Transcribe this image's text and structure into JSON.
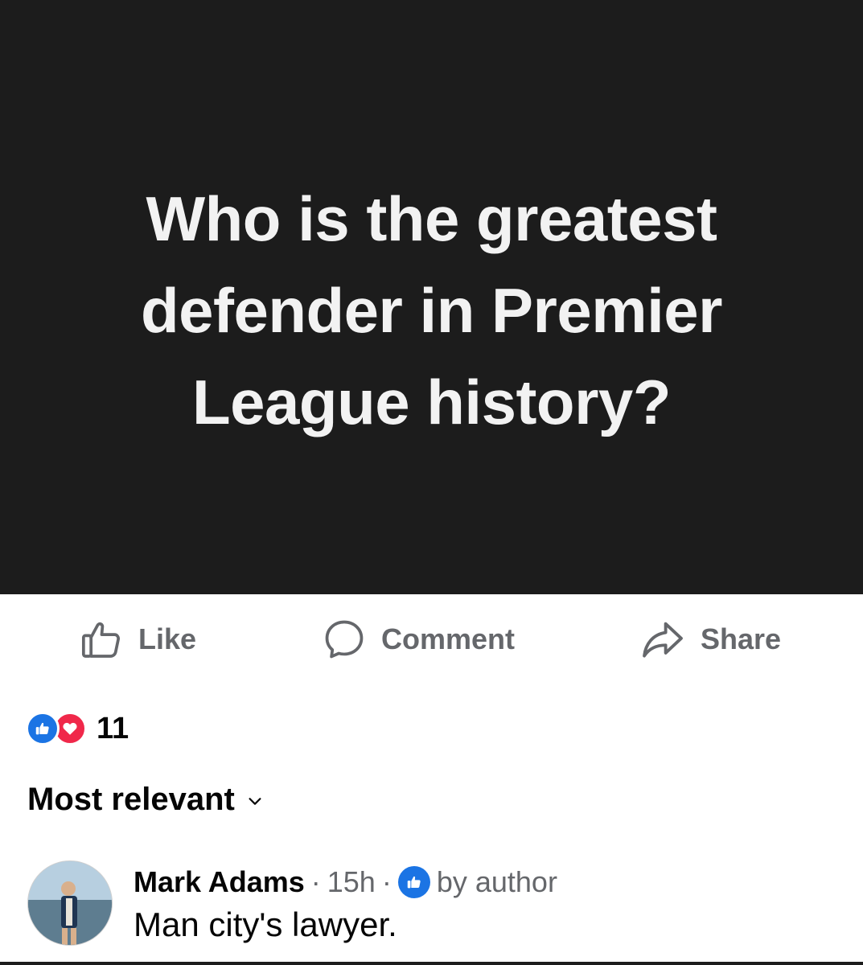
{
  "post": {
    "text_lines": [
      "Who is the greatest",
      "defender in Premier",
      "League history?"
    ]
  },
  "actions": {
    "like": {
      "label": "Like",
      "icon": "thumbs-up-outline-icon"
    },
    "comment": {
      "label": "Comment",
      "icon": "speech-bubble-icon"
    },
    "share": {
      "label": "Share",
      "icon": "share-arrow-icon"
    }
  },
  "reactions": {
    "icons": [
      "like-reaction-icon",
      "love-reaction-icon"
    ],
    "count": "11"
  },
  "sort": {
    "label": "Most relevant",
    "icon": "chevron-down-icon"
  },
  "comments": [
    {
      "author": "Mark Adams",
      "separator1": "·",
      "time": "15h",
      "separator2": "·",
      "badge_label": "by author",
      "badge_icon": "thumbs-up-badge-icon",
      "text": "Man city's lawyer."
    }
  ],
  "colors": {
    "post_background": "#1c1c1c",
    "post_text": "#f2f2f2",
    "action_gray": "#65676b",
    "like_blue": "#1b74e4",
    "love_red": "#f0284a"
  }
}
